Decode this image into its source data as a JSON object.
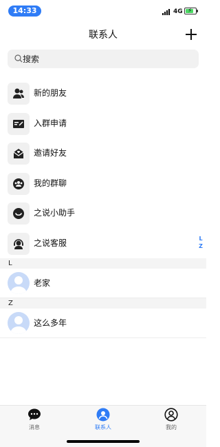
{
  "status_bar": {
    "time": "14:33",
    "network": "4G",
    "battery_state": "charging",
    "signal_icon": "signal-bars-icon",
    "battery_icon": "battery-charging-icon"
  },
  "header": {
    "title": "联系人",
    "add_icon": "plus-icon"
  },
  "search": {
    "placeholder": "搜索",
    "icon": "search-icon"
  },
  "menu": [
    {
      "label": "新的朋友",
      "icon": "new-friends-icon"
    },
    {
      "label": "入群申请",
      "icon": "join-group-request-icon"
    },
    {
      "label": "邀请好友",
      "icon": "invite-friends-icon"
    },
    {
      "label": "我的群聊",
      "icon": "group-chat-icon"
    },
    {
      "label": "之说小助手",
      "icon": "assistant-icon"
    },
    {
      "label": "之说客服",
      "icon": "customer-service-icon"
    }
  ],
  "index_letters": [
    "L",
    "Z"
  ],
  "sections": [
    {
      "letter": "L",
      "contacts": [
        {
          "name": "老家",
          "avatar_icon": "default-avatar-icon"
        }
      ]
    },
    {
      "letter": "Z",
      "contacts": [
        {
          "name": "这么多年",
          "avatar_icon": "default-avatar-icon"
        }
      ]
    }
  ],
  "tabs": [
    {
      "label": "消息",
      "icon": "chat-bubble-icon",
      "active": false
    },
    {
      "label": "联系人",
      "icon": "contacts-icon",
      "active": true
    },
    {
      "label": "我的",
      "icon": "profile-icon",
      "active": false
    }
  ],
  "colors": {
    "accent": "#2f7cf6",
    "icon_bg": "#f0f0f0",
    "avatar_bg": "#c8daf8",
    "section_bg": "#f4f4f4"
  }
}
